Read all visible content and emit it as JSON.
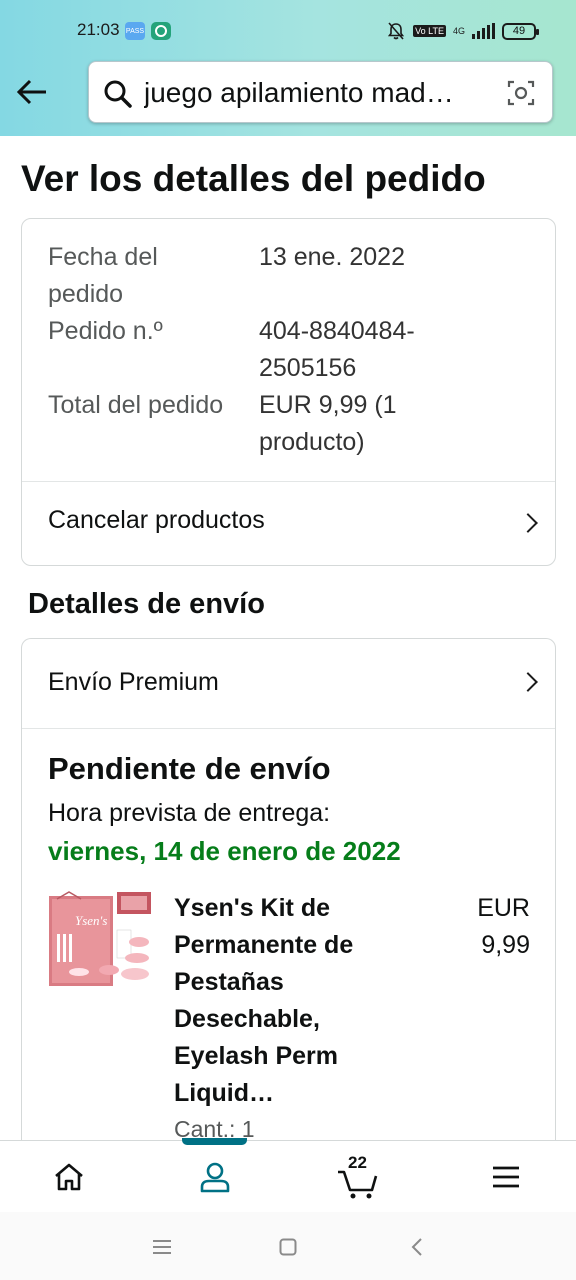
{
  "status_bar": {
    "time": "21:03",
    "battery": "49",
    "network": "4G",
    "lte_badge": "Vo LTE",
    "app_icon_1_text": "PASS"
  },
  "search": {
    "query": "juego apilamiento mad…"
  },
  "page": {
    "title": "Ver los detalles del pedido"
  },
  "order_summary": {
    "date_label": "Fecha del pedido",
    "date_value": "13 ene. 2022",
    "number_label": "Pedido n.º",
    "number_value": "404-8840484-2505156",
    "total_label": "Total del pedido",
    "total_value": "EUR 9,99 (1 producto)",
    "cancel_link": "Cancelar productos"
  },
  "shipping": {
    "section_title": "Detalles de envío",
    "method": "Envío Premium",
    "status": "Pendiente de envío",
    "eta_label": "Hora prevista de entrega:",
    "eta_date": "viernes, 14 de enero de 2022",
    "item": {
      "title": "Ysen's Kit de Permanente de Pestañas Desechable, Eyelash Perm Liquid…",
      "price": "EUR 9,99",
      "quantity": "Cant.: 1",
      "brand_on_box": "Ysen's"
    }
  },
  "bottom_nav": {
    "cart_count": "22",
    "items": [
      "home-icon",
      "account-icon",
      "cart-icon",
      "menu-icon"
    ],
    "active": "account",
    "active_color": "#007185"
  },
  "colors": {
    "delivery_green": "#067d1a",
    "header_gradient_start": "#84d8e3",
    "header_gradient_end": "#a6e6cf"
  }
}
